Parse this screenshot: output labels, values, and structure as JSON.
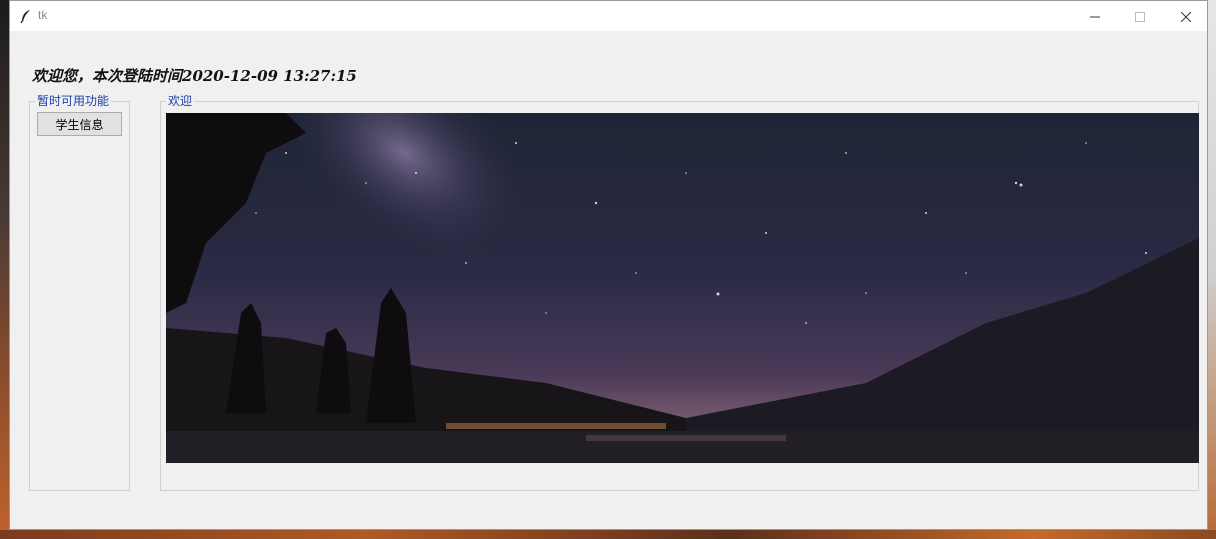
{
  "window": {
    "title": "tk",
    "controls": {
      "minimize_icon": "minimize-icon",
      "maximize_icon": "maximize-icon",
      "close_icon": "close-icon"
    }
  },
  "welcome": {
    "text": "欢迎您，本次登陆时间2020-12-09 13:27:15"
  },
  "left_frame": {
    "label": "暂时可用功能",
    "buttons": [
      {
        "label": "学生信息"
      }
    ]
  },
  "right_frame": {
    "label": "欢迎",
    "image_subject": "night-sky-milky-way-landscape"
  },
  "colors": {
    "frame_label": "#1a3fa8",
    "window_bg": "#f0f0f0",
    "titlebar_bg": "#ffffff"
  }
}
